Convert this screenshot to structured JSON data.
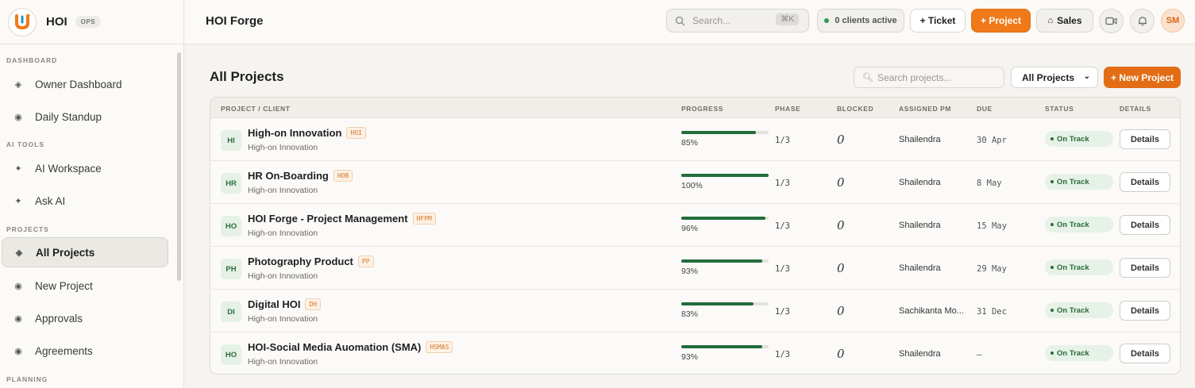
{
  "brand": {
    "name": "HOI",
    "badge": "OPS"
  },
  "sidebar": {
    "sections": [
      {
        "title": "DASHBOARD",
        "items": [
          {
            "label": "Owner Dashboard",
            "icon": "diamond-icon"
          },
          {
            "label": "Daily Standup",
            "icon": "radio-icon"
          }
        ]
      },
      {
        "title": "AI TOOLS",
        "items": [
          {
            "label": "AI Workspace",
            "icon": "sparkle-icon"
          },
          {
            "label": "Ask AI",
            "icon": "sparkle-icon"
          }
        ]
      },
      {
        "title": "PROJECTS",
        "items": [
          {
            "label": "All Projects",
            "icon": "diamond-icon",
            "active": true
          },
          {
            "label": "New Project",
            "icon": "radio-icon"
          },
          {
            "label": "Approvals",
            "icon": "radio-icon"
          },
          {
            "label": "Agreements",
            "icon": "radio-icon"
          }
        ]
      },
      {
        "title": "PLANNING",
        "items": []
      }
    ]
  },
  "header": {
    "title": "HOI Forge",
    "search_placeholder": "Search...",
    "search_shortcut": "⌘K",
    "clients_active": "0 clients active",
    "ticket_label": "+ Ticket",
    "project_label": "+ Project",
    "sales_label": "Sales",
    "avatar_initials": "SM"
  },
  "main": {
    "title": "All Projects",
    "search_placeholder": "Search projects...",
    "filter_value": "All Projects",
    "new_project_label": "+ New Project",
    "columns": [
      "PROJECT / CLIENT",
      "PROGRESS",
      "PHASE",
      "BLOCKED",
      "ASSIGNED PM",
      "DUE",
      "STATUS",
      "DETAILS"
    ],
    "rows": [
      {
        "initials": "HI",
        "name": "High-on Innovation",
        "code": "HOI",
        "client": "High-on Innovation",
        "progress": 85,
        "progress_label": "85%",
        "phase": "1/3",
        "blocked": "0",
        "pm": "Shailendra",
        "due": "30 Apr",
        "status": "On Track",
        "details": "Details"
      },
      {
        "initials": "HR",
        "name": "HR On-Boarding",
        "code": "HOB",
        "client": "High-on Innovation",
        "progress": 100,
        "progress_label": "100%",
        "phase": "1/3",
        "blocked": "0",
        "pm": "Shailendra",
        "due": "8 May",
        "status": "On Track",
        "details": "Details"
      },
      {
        "initials": "HO",
        "name": "HOI Forge - Project Management",
        "code": "HFPM",
        "client": "High-on Innovation",
        "progress": 96,
        "progress_label": "96%",
        "phase": "1/3",
        "blocked": "0",
        "pm": "Shailendra",
        "due": "15 May",
        "status": "On Track",
        "details": "Details"
      },
      {
        "initials": "PH",
        "name": "Photography Product",
        "code": "PP",
        "client": "High-on Innovation",
        "progress": 93,
        "progress_label": "93%",
        "phase": "1/3",
        "blocked": "0",
        "pm": "Shailendra",
        "due": "29 May",
        "status": "On Track",
        "details": "Details"
      },
      {
        "initials": "DI",
        "name": "Digital HOI",
        "code": "DH",
        "client": "High-on Innovation",
        "progress": 83,
        "progress_label": "83%",
        "phase": "1/3",
        "blocked": "0",
        "pm": "Sachikanta Mo...",
        "due": "31 Dec",
        "status": "On Track",
        "details": "Details"
      },
      {
        "initials": "HO",
        "name": "HOI-Social Media Auomation (SMA)",
        "code": "HSMAS",
        "client": "High-on Innovation",
        "progress": 93,
        "progress_label": "93%",
        "phase": "1/3",
        "blocked": "0",
        "pm": "Shailendra",
        "due": "–",
        "status": "On Track",
        "details": "Details"
      }
    ]
  },
  "colors": {
    "accent": "#f07a1a",
    "progress": "#236c3c",
    "status_bg": "#e6f2e7",
    "status_text": "#2a6b3b"
  }
}
